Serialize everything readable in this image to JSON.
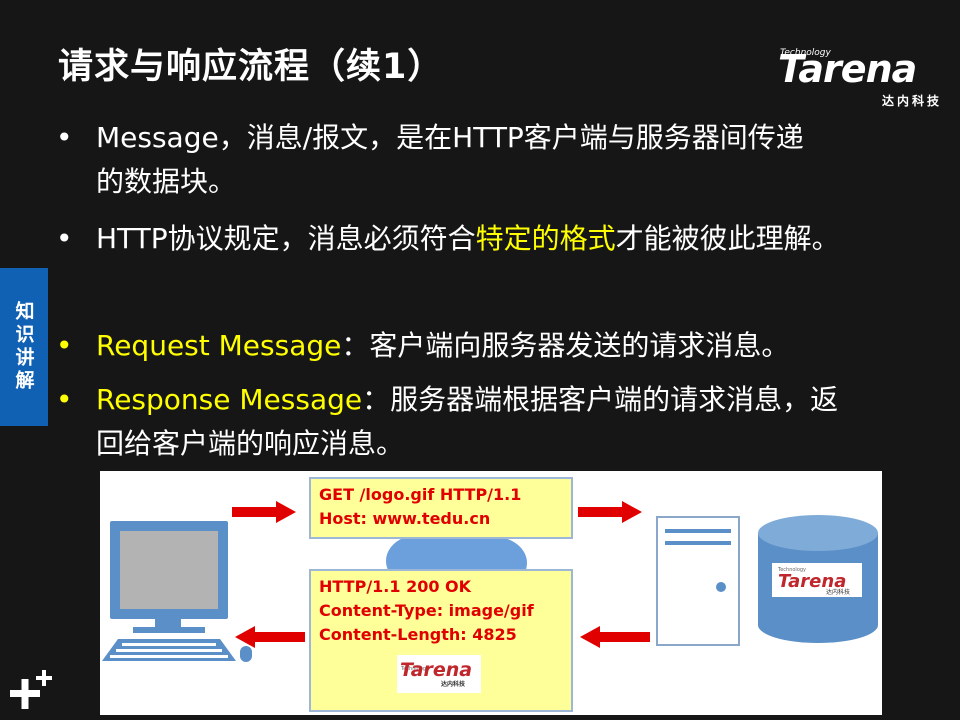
{
  "title": "请求与响应流程（续1）",
  "logo": {
    "small": "Technology",
    "word": "Tarena",
    "sub": "达内科技"
  },
  "side_tab": {
    "label": "知识讲解"
  },
  "bullets": [
    {
      "line1": "Message，消息/报文，是在HTTP客户端与服务器间传递",
      "line2": "的数据块。"
    },
    {
      "pre": "HTTP协议规定，消息必须符合",
      "highlight": "特定的格式",
      "post": "才能被彼此理解。"
    },
    {
      "highlight": "Request Message",
      "post": "：客户端向服务器发送的请求消息。"
    },
    {
      "highlight": "Response Message",
      "post": "：服务器端根据客户端的请求消息，返",
      "line2": "回给客户端的响应消息。"
    }
  ],
  "diagram": {
    "request_box": [
      "GET /logo.gif HTTP/1.1",
      "Host: www.tedu.cn"
    ],
    "response_box": [
      "HTTP/1.1 200 OK",
      "Content-Type: image/gif",
      "Content-Length: 4825"
    ],
    "mini_logo": {
      "small": "Technology",
      "word": "Tarena",
      "sub": "达内科技"
    }
  },
  "colors": {
    "background": "#161616",
    "highlight": "#ffff00",
    "side_tab": "#1060b4",
    "arrow": "#e00000",
    "message_box": "#ffff99"
  },
  "icons": [
    "plus-icon",
    "computer-icon",
    "cloud-icon",
    "server-icon",
    "database-icon"
  ]
}
